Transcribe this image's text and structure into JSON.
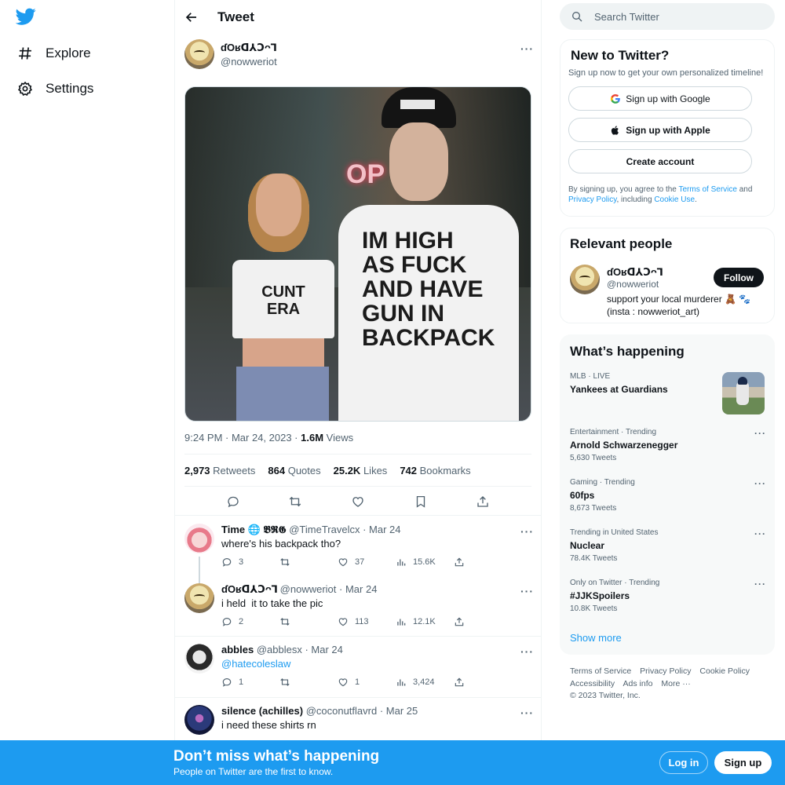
{
  "nav": {
    "items": [
      {
        "label": "Explore",
        "icon": "hashtag-icon"
      },
      {
        "label": "Settings",
        "icon": "gear-icon"
      }
    ]
  },
  "header": {
    "title": "Tweet"
  },
  "tweet": {
    "display_name": "ɗOʁᗡ⅄Ↄᴖ⅂",
    "handle": "@nowweriot",
    "media": {
      "sign_text": "OP",
      "girl_shirt": "CUNT\nERA",
      "boy_shirt": "IM HIGH\nAS FUCK\nAND HAVE\nGUN IN\nBACKPACK"
    },
    "time": "9:24 PM · Mar 24, 2023 ·",
    "views_count": "1.6M",
    "views_label": "Views",
    "stats": [
      {
        "value": "2,973",
        "label": "Retweets"
      },
      {
        "value": "864",
        "label": "Quotes"
      },
      {
        "value": "25.2K",
        "label": "Likes"
      },
      {
        "value": "742",
        "label": "Bookmarks"
      }
    ]
  },
  "replies": [
    {
      "name": "Time 🌐 𝕭𝕽𝕲",
      "handle": "@TimeTravelcx",
      "date": "· Mar 24",
      "text": "where's his backpack tho?",
      "is_link": false,
      "replies": "3",
      "retweets": "",
      "likes": "37",
      "views": "15.6K"
    },
    {
      "name": "ɗOʁᗡ⅄Ↄᴖ⅂",
      "handle": "@nowweriot",
      "date": "· Mar 24",
      "text": "i held  it to take the pic",
      "is_link": false,
      "replies": "2",
      "retweets": "",
      "likes": "113",
      "views": "12.1K"
    },
    {
      "name": "abbles",
      "handle": "@abblesx",
      "date": "· Mar 24",
      "text": "@hatecoleslaw",
      "is_link": true,
      "replies": "1",
      "retweets": "",
      "likes": "1",
      "views": "3,424"
    },
    {
      "name": "silence (achilles)",
      "handle": "@coconutflavrd",
      "date": "· Mar 25",
      "text": "i need these shirts rn",
      "is_link": false
    }
  ],
  "search": {
    "placeholder": "Search Twitter"
  },
  "signup_card": {
    "title": "New to Twitter?",
    "subtitle": "Sign up now to get your own personalized timeline!",
    "google": "Sign up with Google",
    "apple": "Sign up with Apple",
    "create": "Create account",
    "terms_prefix": "By signing up, you agree to the",
    "terms_link": "Terms of Service",
    "terms_and": "and",
    "privacy_link": "Privacy Policy",
    "including": ", including",
    "cookie_link": "Cookie Use",
    "period": "."
  },
  "relevant": {
    "title": "Relevant people",
    "name": "ɗOʁᗡ⅄Ↄᴖ⅂",
    "handle": "@nowweriot",
    "bio": "support your local murderer 🧸 🐾 (insta : nowweriot_art)",
    "follow": "Follow"
  },
  "happening": {
    "title": "What’s happening",
    "trends": [
      {
        "context": "MLB · LIVE",
        "name": "Yankees at Guardians",
        "count": ""
      },
      {
        "context": "Entertainment · Trending",
        "name": "Arnold Schwarzenegger",
        "count": "5,630 Tweets"
      },
      {
        "context": "Gaming · Trending",
        "name": "60fps",
        "count": "8,673 Tweets"
      },
      {
        "context": "Trending in United States",
        "name": "Nuclear",
        "count": "78.4K Tweets"
      },
      {
        "context": "Only on Twitter · Trending",
        "name": "#JJKSpoilers",
        "count": "10.8K Tweets"
      }
    ],
    "show_more": "Show more"
  },
  "footer": {
    "links": [
      "Terms of Service",
      "Privacy Policy",
      "Cookie Policy",
      "Accessibility",
      "Ads info",
      "More ···"
    ],
    "copyright": "© 2023 Twitter, Inc."
  },
  "bottom_bar": {
    "title": "Don’t miss what’s happening",
    "subtitle": "People on Twitter are the first to know.",
    "login": "Log in",
    "signup": "Sign up"
  },
  "colors": {
    "accent": "#1d9bf0",
    "text": "#0f1419",
    "muted": "#536471"
  }
}
